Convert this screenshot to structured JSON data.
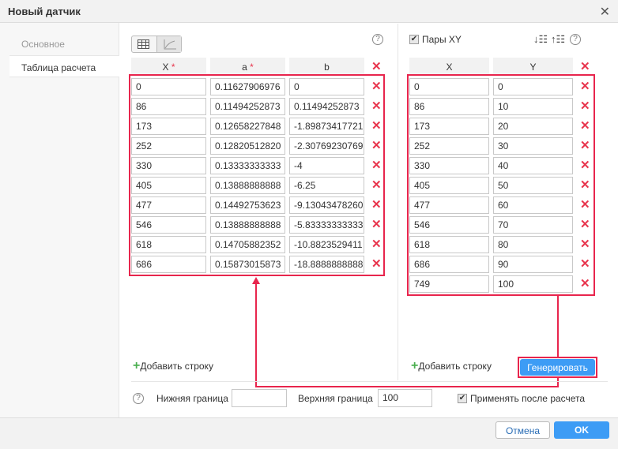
{
  "window": {
    "title": "Новый датчик",
    "close_icon": "close-icon"
  },
  "sidebar": {
    "items": [
      {
        "label": "Основное",
        "active": false
      },
      {
        "label": "Таблица расчета",
        "active": true
      }
    ]
  },
  "left_table": {
    "headers": [
      "X",
      "a",
      "b"
    ],
    "required": [
      "*",
      "*",
      ""
    ],
    "rows": [
      [
        "0",
        "0.11627906976",
        "0"
      ],
      [
        "86",
        "0.11494252873",
        "0.11494252873"
      ],
      [
        "173",
        "0.12658227848",
        "-1.89873417721"
      ],
      [
        "252",
        "0.12820512820",
        "-2.30769230769"
      ],
      [
        "330",
        "0.13333333333",
        "-4"
      ],
      [
        "405",
        "0.13888888888",
        "-6.25"
      ],
      [
        "477",
        "0.14492753623",
        "-9.13043478260"
      ],
      [
        "546",
        "0.13888888888",
        "-5.83333333333"
      ],
      [
        "618",
        "0.14705882352",
        "-10.8823529411"
      ],
      [
        "686",
        "0.15873015873",
        "-18.8888888888"
      ]
    ],
    "add_row": "Добавить строку"
  },
  "right_table": {
    "pairs_label": "Пары XY",
    "pairs_checked": true,
    "headers": [
      "X",
      "Y"
    ],
    "rows": [
      [
        "0",
        "0"
      ],
      [
        "86",
        "10"
      ],
      [
        "173",
        "20"
      ],
      [
        "252",
        "30"
      ],
      [
        "330",
        "40"
      ],
      [
        "405",
        "50"
      ],
      [
        "477",
        "60"
      ],
      [
        "546",
        "70"
      ],
      [
        "618",
        "80"
      ],
      [
        "686",
        "90"
      ],
      [
        "749",
        "100"
      ]
    ],
    "add_row": "Добавить строку",
    "generate": "Генерировать"
  },
  "bounds": {
    "lower_label": "Нижняя граница",
    "lower_value": "",
    "upper_label": "Верхняя граница",
    "upper_value": "100",
    "apply_label": "Применять после расчета",
    "apply_checked": true
  },
  "footer": {
    "cancel": "Отмена",
    "ok": "OK"
  },
  "colors": {
    "accent": "#3d9cf5",
    "highlight": "#e8254d",
    "delete": "#e8354d",
    "add": "#4caf50"
  }
}
